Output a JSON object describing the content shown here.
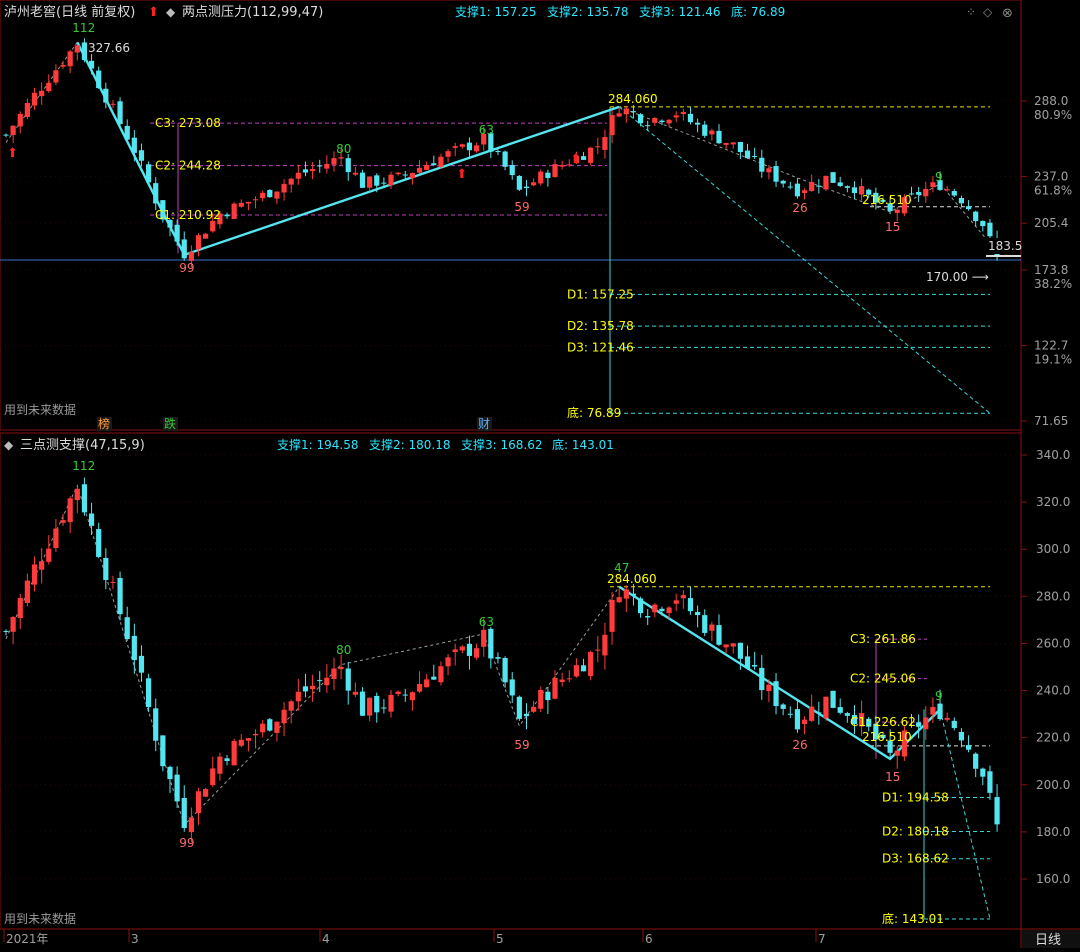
{
  "colors": {
    "up": "#ff3b3b",
    "down": "#54e6f0",
    "trend": "#54e6f0",
    "guide": "#9a9a9a",
    "c_line": "#c040c0",
    "d_line": "#3ad6d6",
    "label_yellow": "#ffff00",
    "label_cyan": "#2ee6ff",
    "label_white": "#dcdcdc",
    "num_green": "#35c935",
    "num_red": "#ff6a6a",
    "axis_text": "#a0a0a0",
    "border": "#8a1010",
    "price_line": "#3a74c8"
  },
  "top_panel": {
    "title": "泸州老窖(日线 前复权)",
    "indicator": "两点测压力(112,99,47)",
    "support_text": [
      "支撑1: 157.25",
      "支撑2: 135.78",
      "支撑3: 121.46",
      "底: 76.89"
    ],
    "future_note": "用到未来数据",
    "event_labels": [
      {
        "id": "bang",
        "text": "榜",
        "color": "#ff9a30"
      },
      {
        "id": "die",
        "text": "跌",
        "color": "#35c935"
      },
      {
        "id": "cai",
        "text": "财",
        "color": "#5ab0ff"
      }
    ],
    "axis_ticks": [
      {
        "value": 288.0,
        "label": "288.0",
        "pct": "80.9%"
      },
      {
        "value": 237.0,
        "label": "237.0",
        "pct": "61.8%"
      },
      {
        "value": 205.4,
        "label": "205.4",
        "pct": ""
      },
      {
        "value": 173.8,
        "label": "173.8",
        "pct": "38.2%"
      },
      {
        "value": 122.7,
        "label": "122.7",
        "pct": "19.1%"
      },
      {
        "value": 71.65,
        "label": "71.65",
        "pct": ""
      }
    ],
    "levels": [
      {
        "id": "C3",
        "text": "C3: 273.08",
        "value": 273.08
      },
      {
        "id": "C2",
        "text": "C2: 244.28",
        "value": 244.28
      },
      {
        "id": "C1",
        "text": "C1: 210.92",
        "value": 210.92
      }
    ],
    "supports": [
      {
        "id": "D1",
        "text": "D1: 157.25",
        "value": 157.25
      },
      {
        "id": "D2",
        "text": "D2: 135.78",
        "value": 135.78
      },
      {
        "id": "D3",
        "text": "D3: 121.46",
        "value": 121.46
      },
      {
        "id": "bottom",
        "text": "底: 76.89",
        "value": 76.89
      }
    ],
    "price_labels": {
      "high": "327.66",
      "peak": "284.060",
      "low_flag": "216.510",
      "current": "183.5",
      "arrow_value": "170.00"
    }
  },
  "bottom_panel": {
    "indicator": "三点测支撑(47,15,9)",
    "support_text": [
      "支撑1: 194.58",
      "支撑2: 180.18",
      "支撑3: 168.62",
      "底: 143.01"
    ],
    "future_note": "用到未来数据",
    "axis_ticks": [
      340,
      320,
      300,
      280,
      260,
      240,
      220,
      200,
      180,
      160
    ],
    "axis_labels": [
      "340.0",
      "320.0",
      "300.0",
      "280.0",
      "260.0",
      "240.0",
      "220.0",
      "200.0",
      "180.0",
      "160.0"
    ],
    "levels": [
      {
        "id": "C3",
        "text": "C3: 261.86",
        "value": 261.86
      },
      {
        "id": "C2",
        "text": "C2: 245.06",
        "value": 245.06
      },
      {
        "id": "C1",
        "text": "C1: 226.62",
        "value": 226.62
      }
    ],
    "supports": [
      {
        "id": "D1",
        "text": "D1: 194.58",
        "value": 194.58
      },
      {
        "id": "D2",
        "text": "D2: 180.18",
        "value": 180.18
      },
      {
        "id": "D3",
        "text": "D3: 168.62",
        "value": 168.62
      },
      {
        "id": "bottom",
        "text": "底: 143.01",
        "value": 143.01
      }
    ],
    "price_labels": {
      "peak": "284.060",
      "low_flag": "216.510"
    }
  },
  "x_axis": {
    "labels": [
      "2021年",
      "3",
      "4",
      "5",
      "6",
      "7"
    ],
    "period": "日线"
  },
  "chart_data": {
    "type": "candlestick",
    "bars_count": 116,
    "swing_points": [
      {
        "label": "112",
        "bar": 10,
        "price": 327.66,
        "color": "green"
      },
      {
        "label": "99",
        "bar": 25,
        "price": 183.0,
        "color": "red"
      },
      {
        "label": "80",
        "bar": 47,
        "price": 251.0,
        "color": "green"
      },
      {
        "label": "63",
        "bar": 67,
        "price": 264.0,
        "color": "green"
      },
      {
        "label": "59",
        "bar": 72,
        "price": 225.0,
        "color": "red"
      },
      {
        "label": "47",
        "bar": 86,
        "price": 284.06,
        "color": "green"
      },
      {
        "label": "26",
        "bar": 111,
        "price": 227.0,
        "color": "red"
      },
      {
        "label": "15",
        "bar": 124,
        "price": 211.0,
        "color": "red"
      },
      {
        "label": "9",
        "bar": 131,
        "price": 232.0,
        "color": "green"
      }
    ],
    "top_ylim": [
      71.65,
      330
    ],
    "bottom_ylim": [
      143,
      345
    ]
  }
}
